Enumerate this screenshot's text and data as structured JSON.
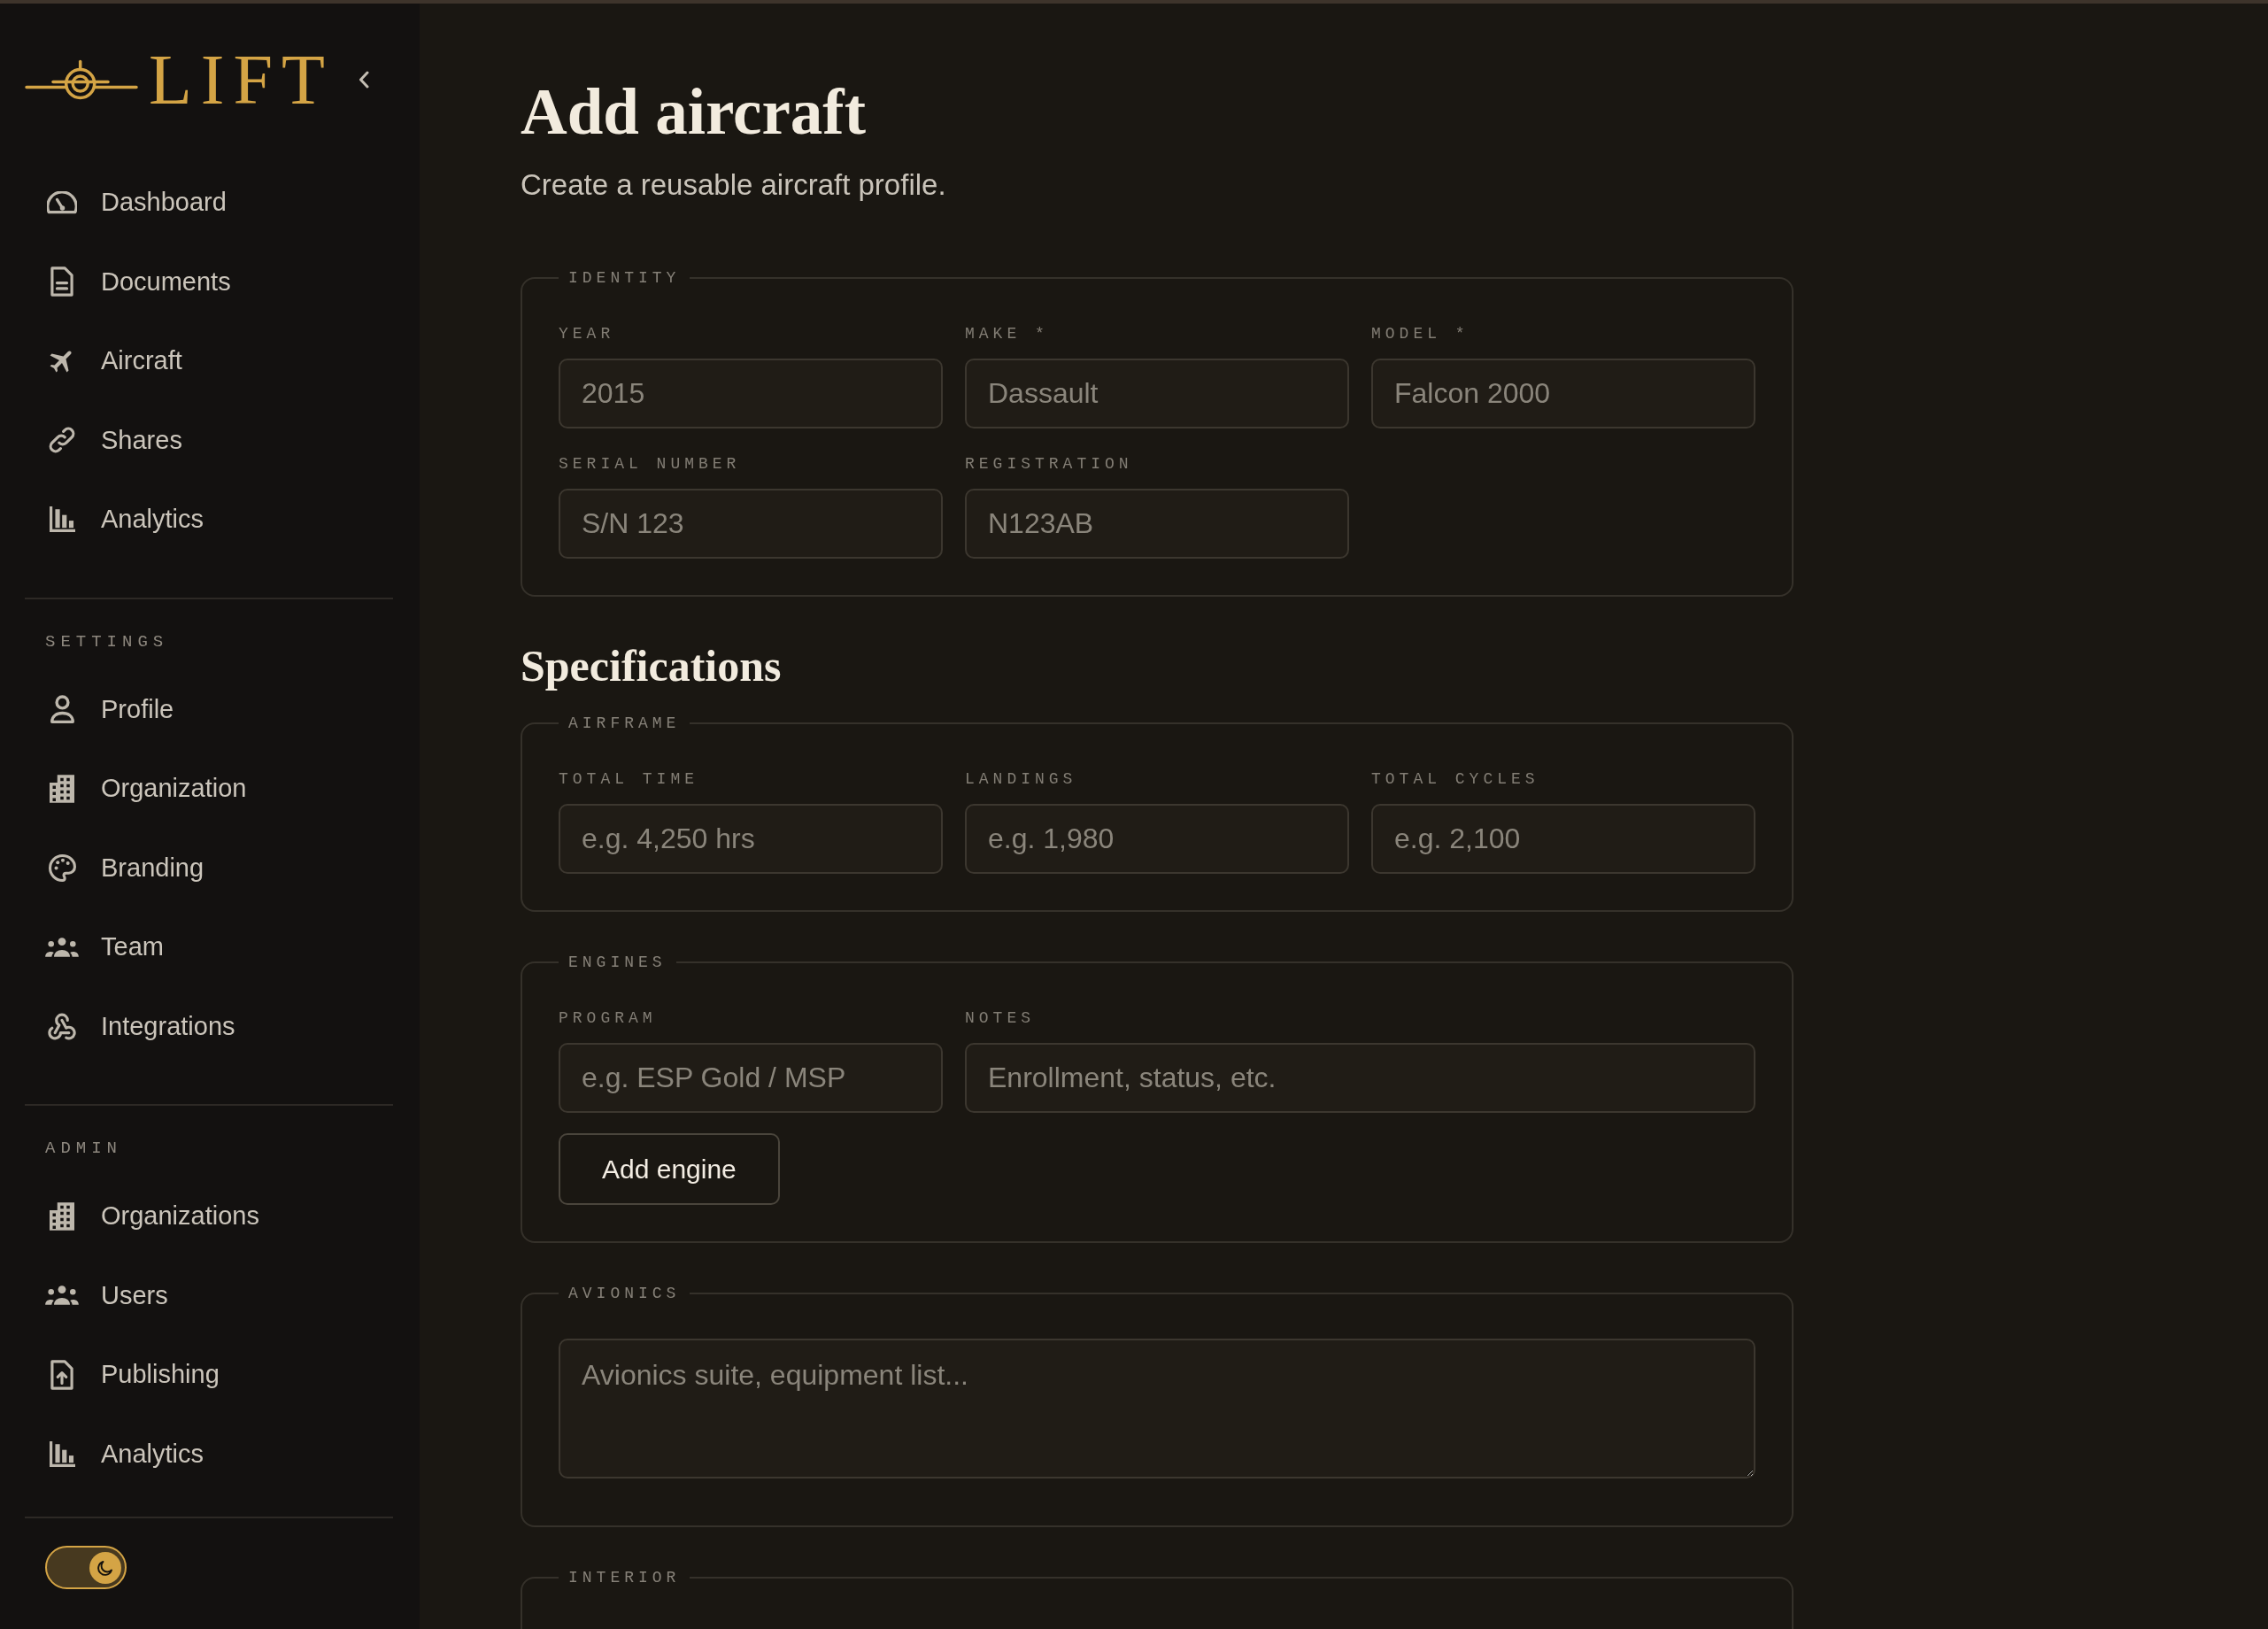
{
  "sidebar": {
    "logo_text": "LIFT",
    "nav": [
      {
        "label": "Dashboard"
      },
      {
        "label": "Documents"
      },
      {
        "label": "Aircraft"
      },
      {
        "label": "Shares"
      },
      {
        "label": "Analytics"
      }
    ],
    "sections": [
      {
        "heading": "SETTINGS",
        "items": [
          {
            "label": "Profile"
          },
          {
            "label": "Organization"
          },
          {
            "label": "Branding"
          },
          {
            "label": "Team"
          },
          {
            "label": "Integrations"
          }
        ]
      },
      {
        "heading": "ADMIN",
        "items": [
          {
            "label": "Organizations"
          },
          {
            "label": "Users"
          },
          {
            "label": "Publishing"
          },
          {
            "label": "Analytics"
          }
        ]
      }
    ],
    "theme_toggle": {
      "on": true
    }
  },
  "main": {
    "title": "Add aircraft",
    "subtitle": "Create a reusable aircraft profile.",
    "blocks": [
      {
        "kind": "fieldset",
        "legend": "IDENTITY",
        "fields": [
          {
            "kind": "input",
            "label": "YEAR",
            "placeholder": "2015"
          },
          {
            "kind": "input",
            "label": "MAKE *",
            "placeholder": "Dassault"
          },
          {
            "kind": "input",
            "label": "MODEL *",
            "placeholder": "Falcon 2000"
          },
          {
            "kind": "input",
            "label": "SERIAL NUMBER",
            "placeholder": "S/N 123"
          },
          {
            "kind": "input",
            "label": "REGISTRATION",
            "placeholder": "N123AB"
          }
        ]
      },
      {
        "kind": "heading",
        "text": "Specifications"
      },
      {
        "kind": "fieldset",
        "legend": "AIRFRAME",
        "fields": [
          {
            "kind": "input",
            "label": "TOTAL TIME",
            "placeholder": "e.g. 4,250 hrs"
          },
          {
            "kind": "input",
            "label": "LANDINGS",
            "placeholder": "e.g. 1,980"
          },
          {
            "kind": "input",
            "label": "TOTAL CYCLES",
            "placeholder": "e.g. 2,100"
          }
        ]
      },
      {
        "kind": "fieldset",
        "legend": "ENGINES",
        "fields": [
          {
            "kind": "input",
            "label": "PROGRAM",
            "placeholder": "e.g. ESP Gold / MSP"
          },
          {
            "kind": "wide",
            "label": "NOTES",
            "placeholder": "Enrollment, status, etc."
          }
        ],
        "button": "Add engine"
      },
      {
        "kind": "fieldset",
        "legend": "AVIONICS",
        "fields": [
          {
            "kind": "textarea",
            "placeholder": "Avionics suite, equipment list..."
          }
        ]
      },
      {
        "kind": "fieldset",
        "legend": "INTERIOR"
      }
    ]
  }
}
